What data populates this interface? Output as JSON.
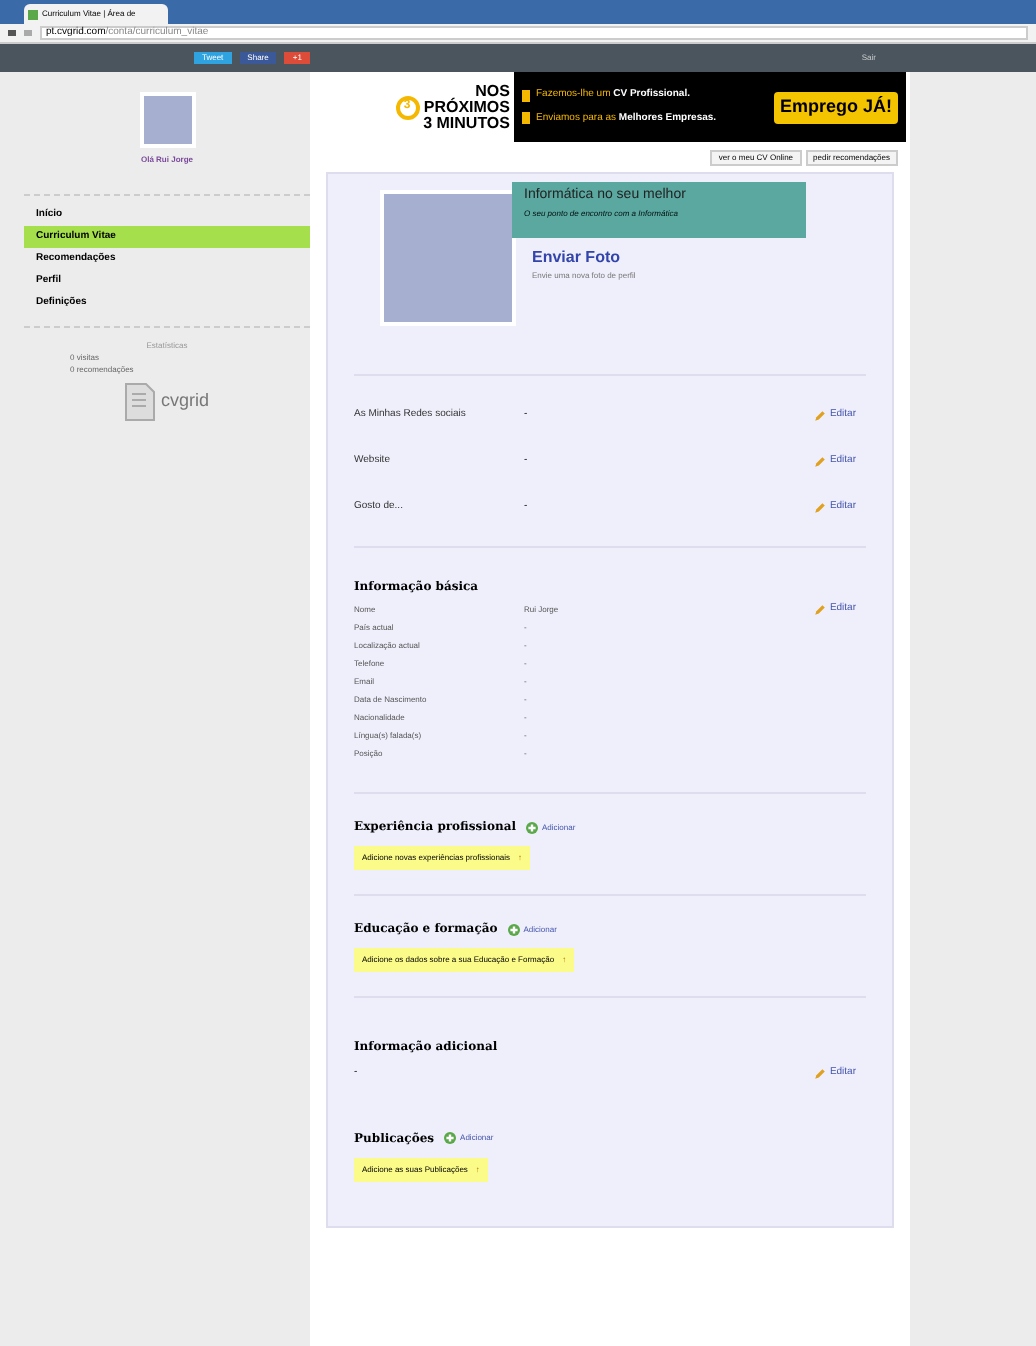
{
  "browser": {
    "tab_title": "Curriculum Vitae | Área de",
    "url_host": "pt.cvgrid.com",
    "url_path": "/conta/curriculum_vitae"
  },
  "topbar": {
    "share_buttons": [
      {
        "kind": "tweet",
        "label": "Tweet"
      },
      {
        "kind": "share",
        "label": "Share"
      },
      {
        "kind": "plus",
        "label": "+1"
      }
    ],
    "logout": "Sair"
  },
  "sidebar": {
    "greeting": "Olá Rui Jorge",
    "items": [
      {
        "label": "Início",
        "selected": false
      },
      {
        "label": "Curriculum Vitae",
        "selected": true
      },
      {
        "label": "Recomendações",
        "selected": false
      },
      {
        "label": "Perfil",
        "selected": false
      },
      {
        "label": "Definições",
        "selected": false
      }
    ],
    "stats_title": "Estatísticas",
    "stats": [
      "0 visitas",
      "0 recomendações"
    ],
    "logo": "cvgrid"
  },
  "ad": {
    "headline": [
      "NOS",
      "PRÓXIMOS",
      "3 MINUTOS"
    ],
    "badge": "3",
    "lines": [
      "Fazemos-lhe um **CV Profissional.**",
      "Enviamos para as **Melhores Empresas.**"
    ],
    "cta": "Emprego JÁ!"
  },
  "actions": [
    "ver o meu CV Online",
    "pedir recomendações"
  ],
  "banner": {
    "title": "Informática no seu melhor",
    "subtitle": "O seu ponto de encontro com a Informática"
  },
  "photo": {
    "title": "Enviar Foto",
    "subtitle": "Envie uma nova foto de perfil"
  },
  "links": [
    {
      "label": "As Minhas Redes sociais",
      "value": "-",
      "edit": "Editar"
    },
    {
      "label": "Website",
      "value": "-",
      "edit": "Editar"
    },
    {
      "label": "Gosto de...",
      "value": "-",
      "edit": "Editar"
    }
  ],
  "basic": {
    "title": "Informação básica",
    "edit": "Editar",
    "fields": [
      {
        "label": "Nome",
        "value": "Rui Jorge"
      },
      {
        "label": "País actual",
        "value": "-"
      },
      {
        "label": "Localização actual",
        "value": "-"
      },
      {
        "label": "Telefone",
        "value": "-"
      },
      {
        "label": "Email",
        "value": "-"
      },
      {
        "label": "Data de Nascimento",
        "value": "-"
      },
      {
        "label": "Nacionalidade",
        "value": "-"
      },
      {
        "label": "Língua(s) falada(s)",
        "value": "-"
      },
      {
        "label": "Posição",
        "value": "-"
      }
    ]
  },
  "sections": [
    {
      "kind": "add",
      "title": "Experiência profissional",
      "action": "Adicionar",
      "hint": "Adicione novas experiências profissionais",
      "arrow": "↑"
    },
    {
      "kind": "add",
      "title": "Educação e formação",
      "action": "Adicionar",
      "hint": "Adicione os dados sobre a sua Educação e Formação",
      "arrow": "↑"
    },
    {
      "kind": "edit",
      "title": "Informação adicional",
      "value": "-",
      "action": "Editar"
    },
    {
      "kind": "add",
      "title": "Publicações",
      "action": "Adicionar",
      "hint": "Adicione as suas Publicações",
      "arrow": "↑"
    }
  ]
}
